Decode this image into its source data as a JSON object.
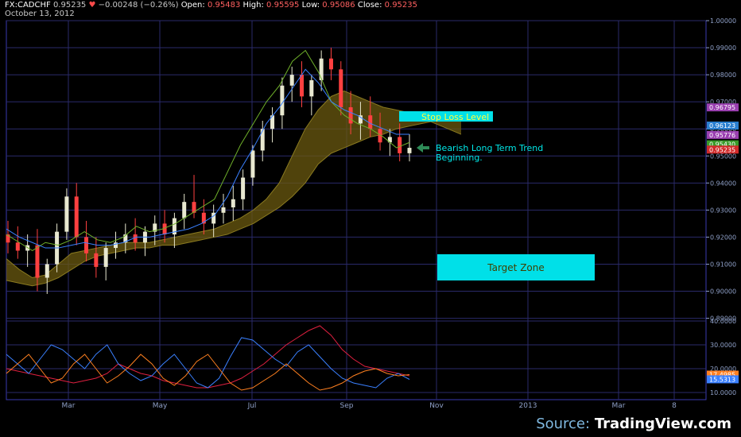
{
  "header": {
    "symbol": "FX:CADCHF",
    "last": "0.95235",
    "change": "−0.00248 (−0.26%)",
    "open_label": "Open:",
    "open": "0.95483",
    "high_label": "High:",
    "high": "0.95595",
    "low_label": "Low:",
    "low": "0.95086",
    "close_label": "Close:",
    "close": "0.95235",
    "date": "October 13, 2012"
  },
  "source": {
    "prefix": "Source:",
    "name": "TradingView.com"
  },
  "annotations": {
    "stop_loss": "Stop Loss Level",
    "trend_line1": "Bearish Long Term Trend",
    "trend_line2": "Beginning.",
    "target": "Target Zone"
  },
  "colors": {
    "background": "#000000",
    "grid": "#2a2a6a",
    "border": "#3a3ab0",
    "candle": "#e8e8d0",
    "candle_down": "#ff4040",
    "cloud": "#6b5a10",
    "tenkan": "#6fb02a",
    "kijun": "#3a80ff",
    "annotation_box": "#00e0e8",
    "annotation_text": "#00e8e8",
    "arrow": "#2e8b57",
    "adx": "#e02040",
    "di_plus": "#3a80ff",
    "di_minus": "#ff8020"
  },
  "chart_data": [
    {
      "type": "line",
      "subtype": "candlestick with ichimoku cloud",
      "x_ticks": [
        "Mar",
        "May",
        "Jul",
        "Sep",
        "Nov",
        "2013",
        "Mar",
        "8"
      ],
      "y_ticks": [
        "1.00000",
        "0.99000",
        "0.98000",
        "0.97000",
        "0.96000",
        "0.95000",
        "0.94000",
        "0.93000",
        "0.92000",
        "0.91000",
        "0.90000",
        "0.89000"
      ],
      "ylim": [
        0.889,
        1.0
      ],
      "price_labels": [
        {
          "text": "0.96795",
          "value": 0.96795,
          "color": "#9a3fb0"
        },
        {
          "text": "0.96123",
          "value": 0.96123,
          "color": "#2a7fd0"
        },
        {
          "text": "0.95776",
          "value": 0.95776,
          "color": "#9a3fb0"
        },
        {
          "text": "0.95430",
          "value": 0.9543,
          "color": "#3a9a2a"
        },
        {
          "text": "0.95235",
          "value": 0.95235,
          "color": "#d02a2a"
        }
      ],
      "series": [
        {
          "role": "tenkan",
          "values": [
            0.921,
            0.918,
            0.915,
            0.918,
            0.917,
            0.919,
            0.922,
            0.919,
            0.918,
            0.92,
            0.924,
            0.922,
            0.923,
            0.925,
            0.928,
            0.931,
            0.934,
            0.944,
            0.954,
            0.962,
            0.97,
            0.976,
            0.985,
            0.989,
            0.981,
            0.97,
            0.965,
            0.962,
            0.96,
            0.957,
            0.953,
            0.955
          ]
        },
        {
          "role": "kijun",
          "values": [
            0.923,
            0.92,
            0.918,
            0.916,
            0.916,
            0.917,
            0.918,
            0.917,
            0.917,
            0.918,
            0.92,
            0.92,
            0.921,
            0.922,
            0.923,
            0.925,
            0.928,
            0.935,
            0.945,
            0.953,
            0.962,
            0.968,
            0.975,
            0.982,
            0.977,
            0.97,
            0.967,
            0.965,
            0.962,
            0.96,
            0.958,
            0.958
          ]
        },
        {
          "role": "span_a",
          "values": [
            0.912,
            0.908,
            0.905,
            0.906,
            0.91,
            0.914,
            0.915,
            0.916,
            0.917,
            0.918,
            0.918,
            0.918,
            0.919,
            0.92,
            0.921,
            0.922,
            0.923,
            0.925,
            0.927,
            0.93,
            0.934,
            0.94,
            0.95,
            0.96,
            0.967,
            0.972,
            0.974,
            0.972,
            0.97,
            0.968,
            0.967,
            0.966,
            0.964,
            0.962,
            0.96,
            0.958
          ]
        },
        {
          "role": "span_b",
          "values": [
            0.904,
            0.903,
            0.902,
            0.903,
            0.905,
            0.908,
            0.911,
            0.913,
            0.914,
            0.915,
            0.916,
            0.916,
            0.917,
            0.917,
            0.918,
            0.919,
            0.92,
            0.921,
            0.923,
            0.925,
            0.928,
            0.931,
            0.935,
            0.94,
            0.947,
            0.951,
            0.953,
            0.955,
            0.957,
            0.958,
            0.96,
            0.961,
            0.962,
            0.963,
            0.963,
            0.964
          ]
        }
      ],
      "candles": [
        [
          0.921,
          0.926,
          0.914,
          0.918
        ],
        [
          0.918,
          0.924,
          0.912,
          0.915
        ],
        [
          0.915,
          0.921,
          0.909,
          0.917
        ],
        [
          0.917,
          0.923,
          0.9,
          0.905
        ],
        [
          0.905,
          0.912,
          0.899,
          0.91
        ],
        [
          0.91,
          0.925,
          0.907,
          0.922
        ],
        [
          0.922,
          0.938,
          0.919,
          0.935
        ],
        [
          0.935,
          0.94,
          0.917,
          0.92
        ],
        [
          0.92,
          0.926,
          0.911,
          0.914
        ],
        [
          0.914,
          0.92,
          0.905,
          0.909
        ],
        [
          0.909,
          0.918,
          0.904,
          0.916
        ],
        [
          0.916,
          0.922,
          0.912,
          0.918
        ],
        [
          0.918,
          0.925,
          0.914,
          0.921
        ],
        [
          0.921,
          0.927,
          0.915,
          0.918
        ],
        [
          0.918,
          0.924,
          0.913,
          0.922
        ],
        [
          0.922,
          0.928,
          0.917,
          0.925
        ],
        [
          0.925,
          0.93,
          0.918,
          0.921
        ],
        [
          0.921,
          0.929,
          0.916,
          0.927
        ],
        [
          0.927,
          0.936,
          0.923,
          0.933
        ],
        [
          0.933,
          0.943,
          0.927,
          0.929
        ],
        [
          0.929,
          0.934,
          0.921,
          0.925
        ],
        [
          0.925,
          0.932,
          0.92,
          0.929
        ],
        [
          0.929,
          0.936,
          0.925,
          0.931
        ],
        [
          0.931,
          0.939,
          0.926,
          0.934
        ],
        [
          0.934,
          0.945,
          0.93,
          0.942
        ],
        [
          0.942,
          0.954,
          0.939,
          0.952
        ],
        [
          0.952,
          0.963,
          0.948,
          0.96
        ],
        [
          0.96,
          0.968,
          0.955,
          0.965
        ],
        [
          0.965,
          0.979,
          0.96,
          0.976
        ],
        [
          0.976,
          0.983,
          0.97,
          0.98
        ],
        [
          0.98,
          0.985,
          0.968,
          0.972
        ],
        [
          0.972,
          0.98,
          0.965,
          0.978
        ],
        [
          0.978,
          0.989,
          0.974,
          0.986
        ],
        [
          0.986,
          0.99,
          0.978,
          0.982
        ],
        [
          0.982,
          0.985,
          0.965,
          0.968
        ],
        [
          0.968,
          0.974,
          0.958,
          0.962
        ],
        [
          0.962,
          0.97,
          0.956,
          0.965
        ],
        [
          0.965,
          0.972,
          0.957,
          0.96
        ],
        [
          0.96,
          0.966,
          0.952,
          0.955
        ],
        [
          0.955,
          0.96,
          0.95,
          0.957
        ],
        [
          0.957,
          0.962,
          0.948,
          0.951
        ],
        [
          0.951,
          0.958,
          0.948,
          0.953
        ]
      ]
    },
    {
      "type": "line",
      "subtype": "ADX / DMI oscillator",
      "y_ticks": [
        "40.0000",
        "30.0000",
        "20.0000",
        "10.0000"
      ],
      "ylim": [
        7,
        40
      ],
      "value_labels": [
        {
          "text": "17.4985",
          "value": 17.4985,
          "color": "#ff8020"
        },
        {
          "text": "15.5313",
          "value": 15.5313,
          "color": "#3a80ff"
        }
      ],
      "series": [
        {
          "role": "adx",
          "values": [
            20,
            19,
            18,
            17,
            16,
            15,
            14,
            15,
            16,
            18,
            22,
            20,
            18,
            17,
            15,
            14,
            13,
            12,
            12,
            13,
            14,
            16,
            19,
            22,
            26,
            30,
            33,
            36,
            38,
            34,
            28,
            24,
            21,
            20,
            19,
            18,
            17
          ]
        },
        {
          "role": "di_plus",
          "values": [
            26,
            22,
            18,
            24,
            30,
            28,
            24,
            20,
            26,
            30,
            22,
            18,
            15,
            17,
            22,
            26,
            20,
            14,
            12,
            16,
            25,
            33,
            32,
            28,
            24,
            21,
            27,
            30,
            25,
            20,
            16,
            14,
            13,
            12,
            16,
            18,
            15.5
          ]
        },
        {
          "role": "di_minus",
          "values": [
            18,
            22,
            26,
            20,
            14,
            16,
            22,
            26,
            20,
            14,
            17,
            21,
            26,
            22,
            16,
            13,
            17,
            23,
            26,
            20,
            14,
            11,
            12,
            15,
            18,
            22,
            18,
            14,
            11,
            12,
            14,
            17,
            19,
            20,
            18,
            17,
            17.5
          ]
        }
      ]
    }
  ]
}
